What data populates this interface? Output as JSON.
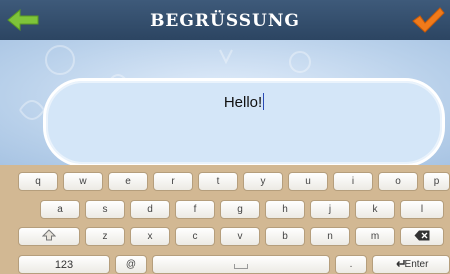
{
  "header": {
    "title": "BEGRÜSSUNG",
    "back_icon": "arrow-left-icon",
    "confirm_icon": "checkmark-icon"
  },
  "editor": {
    "text": "Hello!"
  },
  "keyboard": {
    "row1": [
      "q",
      "w",
      "e",
      "r",
      "t",
      "y",
      "u",
      "i",
      "o",
      "p"
    ],
    "row2": [
      "a",
      "s",
      "d",
      "f",
      "g",
      "h",
      "j",
      "k",
      "l"
    ],
    "row3": [
      "z",
      "x",
      "c",
      "v",
      "b",
      "n",
      "m"
    ],
    "numbers_label": "123",
    "at_label": "@",
    "dot_label": ".",
    "enter_label": "Enter"
  },
  "colors": {
    "accent_green": "#7ec43a",
    "accent_orange": "#f07a1a",
    "header_bg": "#34506f",
    "keyboard_bg": "#d2b893"
  }
}
